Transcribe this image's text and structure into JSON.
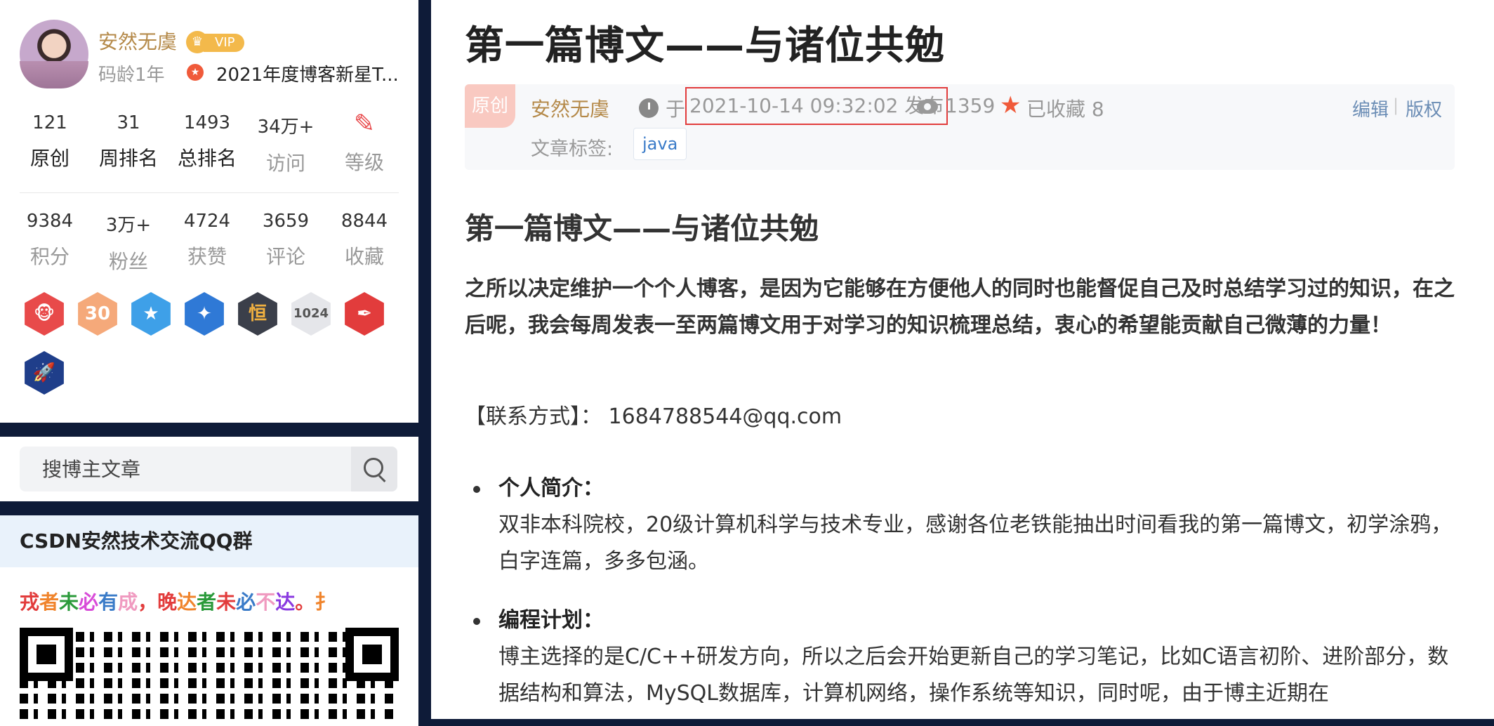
{
  "profile": {
    "username": "安然无虞",
    "vip_label": "VIP",
    "code_age": "码龄1年",
    "honor": "2021年度博客新星T...",
    "stats_row1": [
      {
        "num": "121",
        "label": "原创"
      },
      {
        "num": "31",
        "label": "周排名"
      },
      {
        "num": "1493",
        "label": "总排名"
      },
      {
        "num": "34万+",
        "label": "访问"
      },
      {
        "num": "",
        "label": "等级"
      }
    ],
    "stats_row2": [
      {
        "num": "9384",
        "label": "积分"
      },
      {
        "num": "3万+",
        "label": "粉丝"
      },
      {
        "num": "4724",
        "label": "获赞"
      },
      {
        "num": "3659",
        "label": "评论"
      },
      {
        "num": "8844",
        "label": "收藏"
      }
    ],
    "badges": [
      "monkey-badge-icon",
      "30-badge-icon",
      "star-badge-icon",
      "creator-badge-icon",
      "persist-badge-icon",
      "1024-badge-icon",
      "pen-badge-icon",
      "rocket-badge-icon"
    ]
  },
  "search": {
    "placeholder": "搜博主文章"
  },
  "qq_group": {
    "title": "CSDN安然技术交流QQ群",
    "slogan_chars": [
      "戎",
      "者",
      "未",
      "必",
      "有",
      "成",
      "，",
      "晚",
      "达",
      "者",
      "未",
      "必",
      "不",
      "达",
      "。",
      "扌"
    ],
    "slogan_colors": [
      "#e23c3c",
      "#f0842c",
      "#2a9a3a",
      "#d84bd8",
      "#3a7bc8",
      "#f09ac0",
      "#e23c3c",
      "#e23c3c",
      "#f0842c",
      "#2a9a3a",
      "#e23c3c",
      "#3a7bc8",
      "#f09ac0",
      "#8a3ae0",
      "#e23c3c",
      "#f0842c"
    ]
  },
  "article": {
    "title": "第一篇博文——与诸位共勉",
    "original_badge": "原创",
    "author": "安然无虞",
    "published_prefix": "于",
    "published": "2021-10-14 09:32:02 发布",
    "views": "1359",
    "favorites": "已收藏 8",
    "edit": "编辑",
    "separator": "|",
    "copyright": "版权",
    "tags_label": "文章标签:",
    "tag": "java",
    "heading": "第一篇博文——与诸位共勉",
    "intro": "之所以决定维护一个个人博客，是因为它能够在方便他人的同时也能督促自己及时总结学习过的知识，在之后呢，我会每周发表一至两篇博文用于对学习的知识梳理总结，衷心的希望能贡献自己微薄的力量！",
    "contact": "【联系方式】： 1684788544@qq.com",
    "sections": [
      {
        "head": "个人简介：",
        "body": "双非本科院校，20级计算机科学与技术专业，感谢各位老铁能抽出时间看我的第一篇博文，初学涂鸦，白字连篇，多多包涵。"
      },
      {
        "head": "编程计划：",
        "body": "博主选择的是C/C++研发方向，所以之后会开始更新自己的学习笔记，比如C语言初阶、进阶部分，数据结构和算法，MySQL数据库，计算机网络，操作系统等知识，同时呢，由于博主近期在"
      }
    ]
  }
}
